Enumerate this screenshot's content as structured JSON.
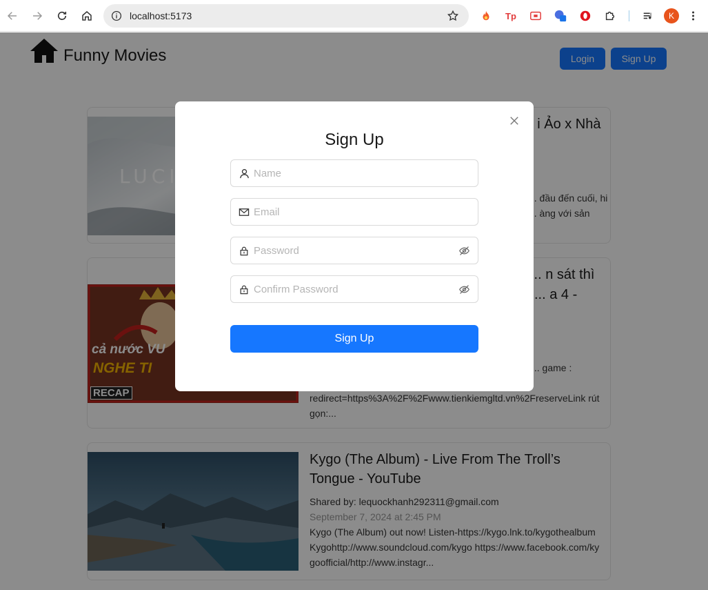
{
  "browser": {
    "url": "localhost:5173",
    "profile_initial": "K",
    "extension_tp_label": "Tp"
  },
  "header": {
    "app_title": "Funny Movies",
    "login_label": "Login",
    "signup_label": "Sign Up"
  },
  "movies": [
    {
      "title": "... i Ảo x Nhà",
      "thumb_text": "LUCI",
      "desc": "... đầu đến cuối, hi ... àng với sản"
    },
    {
      "title_line1": "... n sát thì",
      "title_line2": "... a 4 -",
      "thumb_text1": "cả nước VU",
      "thumb_text2": "NGHE TI",
      "thumb_badge": "RECAP",
      "desc_line1": "... game :",
      "desc_line2": "redirect=https%3A%2F%2Fwww.tienkiemgltd.vn%2FreserveLink rút",
      "desc_line3": "gọn:..."
    },
    {
      "title": "Kygo (The Album) - Live From The Troll’s Tongue - YouTube",
      "shared_by": "Shared by: lequockhanh292311@gmail.com",
      "date": "September 7, 2024 at 2:45 PM",
      "desc": "Kygo (The Album) out now! Listen-https://kygo.lnk.to/kygothealbumKygohttp://www.soundcloud.com/kygo https://www.facebook.com/kygoofficial/http://www.instagr..."
    }
  ],
  "modal": {
    "title": "Sign Up",
    "name_placeholder": "Name",
    "email_placeholder": "Email",
    "password_placeholder": "Password",
    "confirm_placeholder": "Confirm Password",
    "submit_label": "Sign Up"
  },
  "colors": {
    "primary": "#1677ff",
    "overlay": "rgba(0,0,0,0.45)"
  }
}
